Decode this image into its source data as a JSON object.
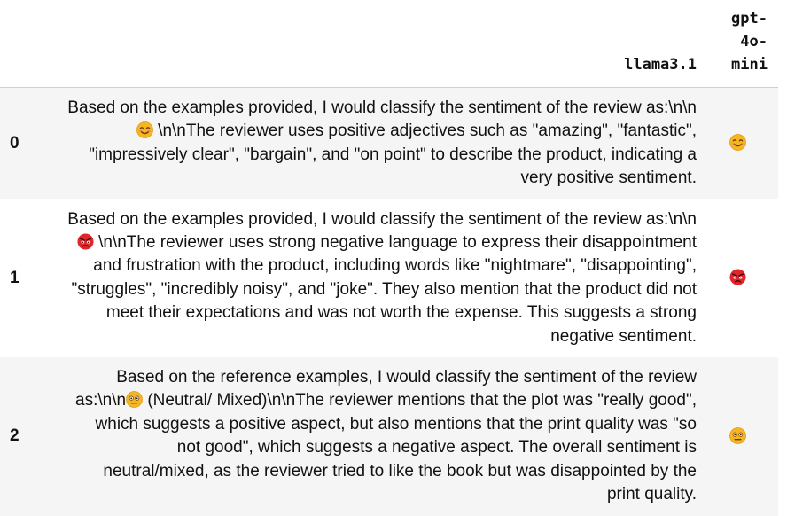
{
  "table": {
    "columns": [
      "llama3.1",
      "gpt-\n4o-\nmini"
    ],
    "column_lines": {
      "llama": "llama3.1",
      "gpt": [
        "gpt-",
        "4o-",
        "mini"
      ]
    },
    "rows": [
      {
        "index": "0",
        "llama_before": "Based on the examples provided, I would classify the sentiment of the review as:\\n\\n",
        "llama_emoji": "smiling-face-icon",
        "llama_after": " \\n\\nThe reviewer uses positive adjectives such as \"amazing\", \"fantastic\", \"impressively clear\", \"bargain\", and \"on point\" to describe the product, indicating a very positive sentiment.",
        "gpt_emoji": "smiling-face-icon"
      },
      {
        "index": "1",
        "llama_before": "Based on the examples provided, I would classify the sentiment of the review as:\\n\\n",
        "llama_emoji": "angry-face-icon",
        "llama_after": " \\n\\nThe reviewer uses strong negative language to express their disappointment and frustration with the product, including words like \"nightmare\", \"disappointing\", \"struggles\", \"incredibly noisy\", and \"joke\". They also mention that the product did not meet their expectations and was not worth the expense. This suggests a strong negative sentiment.",
        "gpt_emoji": "angry-face-icon"
      },
      {
        "index": "2",
        "llama_before": "Based on the reference examples, I would classify the sentiment of the review as:\\n\\n",
        "llama_emoji": "neutral-face-icon",
        "llama_after": "  (Neutral/ Mixed)\\n\\nThe reviewer mentions that the plot was \"really good\", which suggests a positive aspect, but also mentions that the print quality was \"so not good\", which suggests a negative aspect. The overall sentiment is neutral/mixed, as the reviewer tried to like the book but was disappointed by the print quality.",
        "gpt_emoji": "neutral-face-icon"
      }
    ]
  },
  "colors": {
    "odd_row_bg": "#f5f5f5",
    "header_border": "#cfcfcf",
    "smile_face": "#f5b623",
    "angry_face": "#e0262a"
  }
}
